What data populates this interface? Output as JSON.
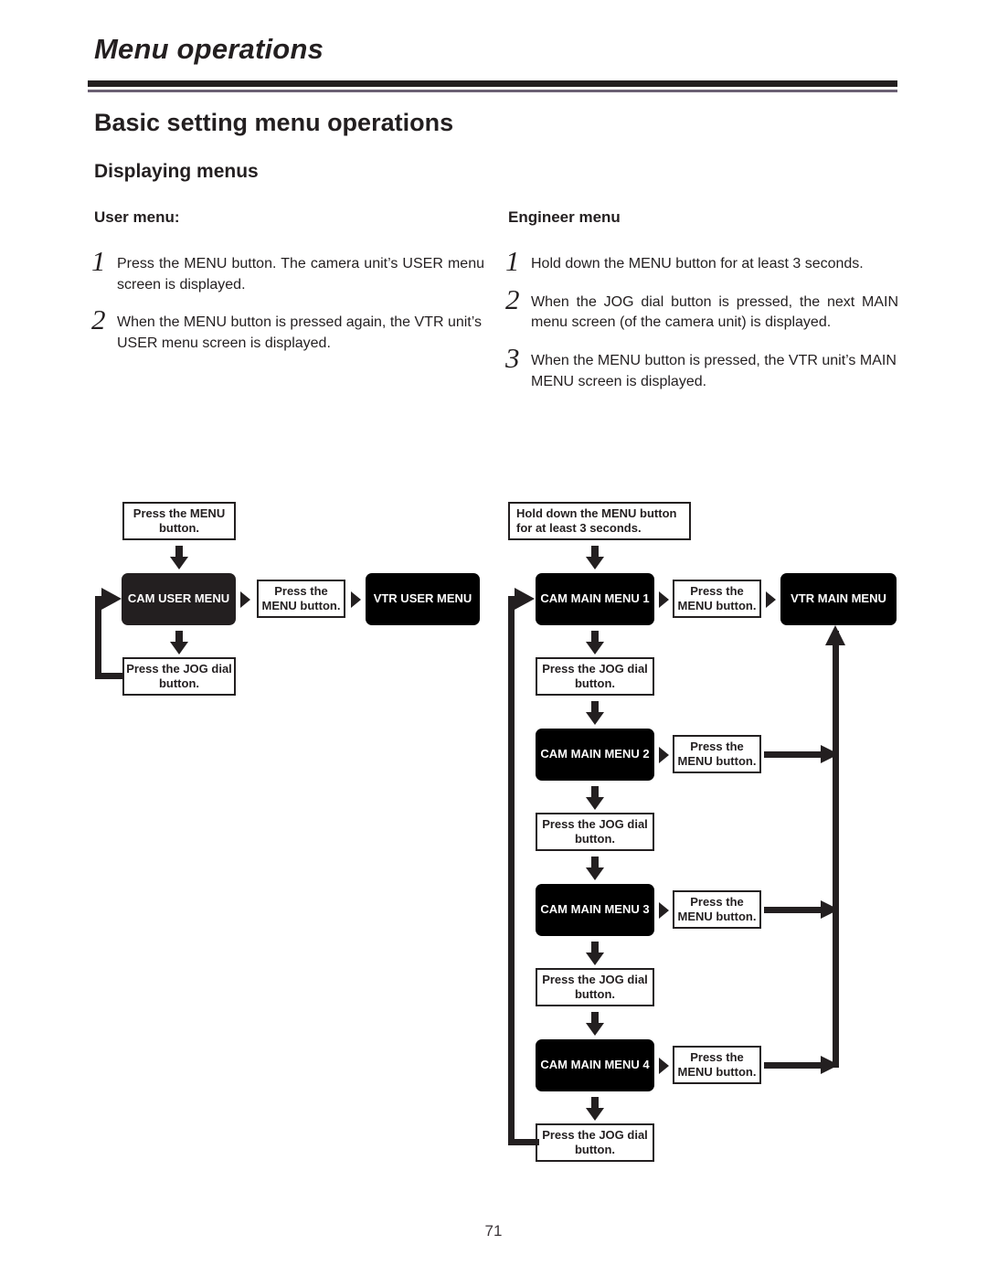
{
  "header": {
    "running_title": "Menu operations",
    "section_title": "Basic setting menu operations",
    "sub_title": "Displaying menus"
  },
  "columns": {
    "left": {
      "heading": "User menu:",
      "steps": [
        {
          "num": "1",
          "text": "Press the MENU button. The camera unit’s USER menu screen is displayed."
        },
        {
          "num": "2",
          "text": "When the MENU button is pressed again, the VTR unit’s USER menu screen is displayed."
        }
      ]
    },
    "right": {
      "heading": "Engineer menu",
      "steps": [
        {
          "num": "1",
          "text": "Hold down the MENU button for at least 3 seconds."
        },
        {
          "num": "2",
          "text": "When the JOG dial button is pressed, the next MAIN menu screen (of the camera unit) is displayed."
        },
        {
          "num": "3",
          "text": "When the MENU button is pressed, the VTR unit’s MAIN MENU screen is displayed."
        }
      ]
    }
  },
  "flow_left": {
    "start_box": "Press the MENU button.",
    "cam_menu": "CAM USER MENU",
    "press_menu": "Press the MENU button.",
    "vtr_menu": "VTR USER MENU",
    "press_jog": "Press the JOG dial button."
  },
  "flow_right": {
    "start_box": "Hold down the MENU button for at least 3 seconds.",
    "vtr_menu": "VTR MAIN MENU",
    "cam_menu_1": "CAM MAIN MENU 1",
    "cam_menu_2": "CAM MAIN MENU 2",
    "cam_menu_3": "CAM MAIN MENU 3",
    "cam_menu_4": "CAM MAIN MENU 4",
    "press_menu_1": "Press the MENU button.",
    "press_menu_2": "Press the MENU button.",
    "press_menu_3": "Press the MENU button.",
    "press_menu_4": "Press the MENU button.",
    "press_jog_1": "Press the JOG dial button.",
    "press_jog_2": "Press the JOG dial button.",
    "press_jog_3": "Press the JOG dial button.",
    "press_jog_4": "Press the JOG dial button."
  },
  "footer": {
    "page_number": "71"
  }
}
